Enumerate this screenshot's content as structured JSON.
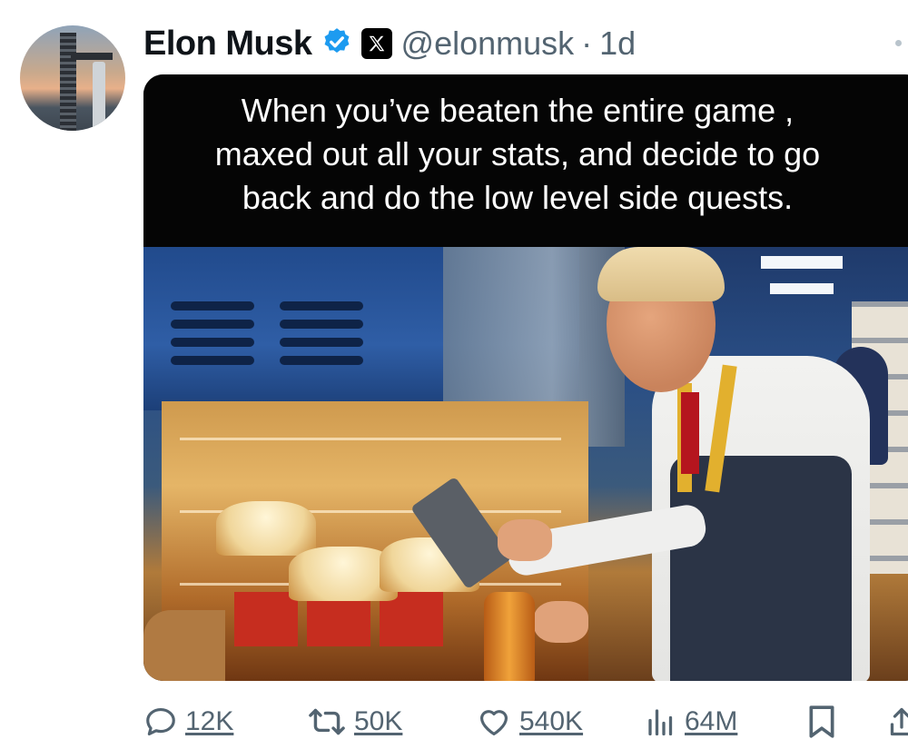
{
  "tweet": {
    "author": {
      "display_name": "Elon Musk",
      "handle": "@elonmusk",
      "verified": true,
      "affiliate_badge_icon": "x-logo-icon"
    },
    "time_separator": "·",
    "time": "1d",
    "media_caption_lines": [
      "When you’ve beaten the entire game ,",
      "maxed out all your stats, and decide to go",
      "back and do the low level side quests."
    ],
    "actions": {
      "replies": "12K",
      "reposts": "50K",
      "likes": "540K",
      "views": "64M"
    }
  },
  "colors": {
    "text_primary": "#0f1419",
    "text_secondary": "#536471",
    "verified_blue": "#1d9bf0",
    "caption_background": "#050505"
  }
}
